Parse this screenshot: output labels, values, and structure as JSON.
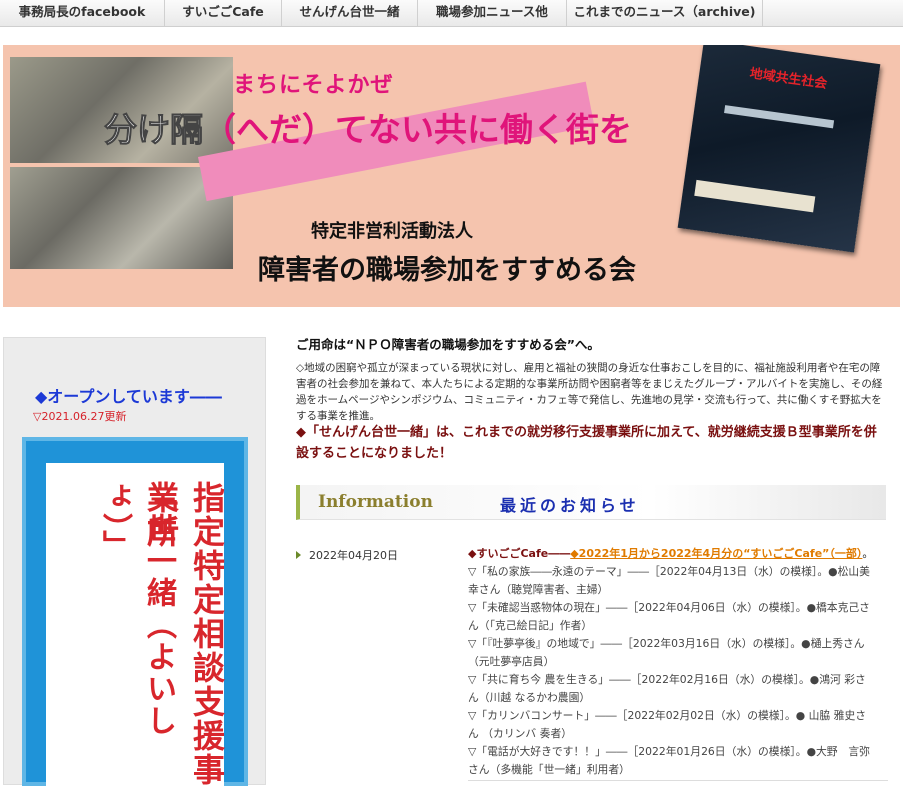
{
  "nav": {
    "items": [
      {
        "label": "事務局長のfacebook"
      },
      {
        "label": "すいごごCafe"
      },
      {
        "label": "せんげん台世一緒"
      },
      {
        "label": "職場参加ニュース他"
      },
      {
        "label": "これまでのニュース（archive)"
      }
    ]
  },
  "banner": {
    "tagline": "まちにそよかぜ",
    "headline_mark": "分け隔",
    "headline_rest": "（へだ）てない共に働く街を",
    "npo_label": "特定非営利活動法人",
    "org_name": "障害者の職場参加をすすめる会",
    "poster_title": "地域共生社会"
  },
  "sidebar": {
    "open_title": "◆オープンしています――",
    "open_date": "▽2021.06.27更新",
    "sign_col1": "指定特定相談支援事業所",
    "sign_col2": "「世一緒（よいしょ）」"
  },
  "main": {
    "mission": "ご用命は“ＮＰＯ障害者の職場参加をすすめる会”へ。",
    "description": "◇地域の困窮や孤立が深まっている現状に対し、雇用と福祉の狭間の身近な仕事おこしを目的に、福祉施設利用者や在宅の障害者の社会参加を兼ねて、本人たちによる定期的な事業所訪問や困窮者等をまじえたグループ・アルバイトを実施し、その経過をホームページやシンポジウム、コミュニティ・カフェ等で発信し、先進地の見学・交流も行って、共に働くすそ野拡大をする事業を推進。",
    "announcement": "◆「せんげん台世一緒」は、これまでの就労移行支援事業所に加えて、就労継続支援Ｂ型事業所を併設することになりました！",
    "info_en": "Information",
    "info_jp": "最近のお知らせ",
    "news": {
      "date": "2022年04月20日",
      "head_a": "◆すいごごCafe――",
      "head_b": "◆2022年1月から2022年4月分の“すいごごCafe”（一部）",
      "head_c": "。",
      "items": [
        "▽「私の家族――永遠のテーマ」――［2022年04月13日（水）の模様］。●松山美幸さん（聴覚障害者、主婦）",
        "▽「未確認当惑物体の現在」――［2022年04月06日（水）の模様］。●橋本克己さん（「克己絵日記」作者）",
        "▽「『吐夢亭後』の地域で」――［2022年03月16日（水）の模様］。●樋上秀さん（元吐夢亭店員）",
        "▽「共に育ち今 農を生きる」――［2022年02月16日（水）の模様］。●鴻河 彩さん（川越 なるかわ農園）",
        "▽「カリンバコンサート」――［2022年02月02日（水）の模様］。● 山脇 雅史さん （カリンバ 奏者）",
        "▽「電話が大好きです！！」――［2022年01月26日（水）の模様］。●大野　言弥さん（多機能「世一緒」利用者）"
      ]
    }
  },
  "colors": {
    "accent_pink": "#e0147a",
    "banner_bg": "#f5c4ae",
    "sign_blue": "#1f93d8",
    "sign_red": "#d8262c",
    "title_blue": "#1c39d6",
    "announce_red": "#7a1010",
    "link_orange": "#e07b00"
  }
}
